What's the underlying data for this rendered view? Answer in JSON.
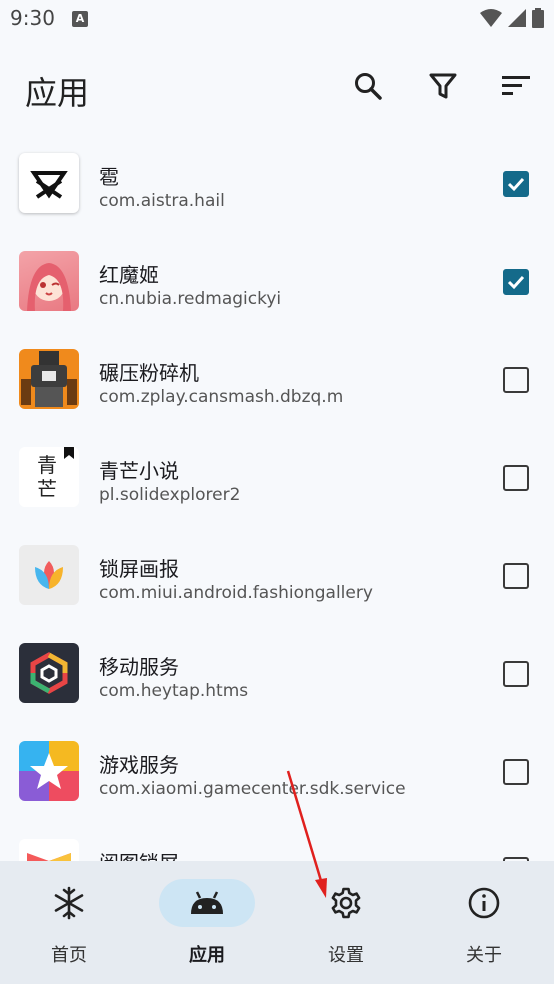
{
  "status": {
    "time": "9:30"
  },
  "appbar": {
    "title": "应用"
  },
  "apps": [
    {
      "name": "雹",
      "package": "com.aistra.hail",
      "checked": true
    },
    {
      "name": "红魔姬",
      "package": "cn.nubia.redmagickyi",
      "checked": true
    },
    {
      "name": "碾压粉碎机",
      "package": "com.zplay.cansmash.dbzq.m",
      "checked": false
    },
    {
      "name": "青芒小说",
      "package": "pl.solidexplorer2",
      "checked": false
    },
    {
      "name": "锁屏画报",
      "package": "com.miui.android.fashiongallery",
      "checked": false
    },
    {
      "name": "移动服务",
      "package": "com.heytap.htms",
      "checked": false
    },
    {
      "name": "游戏服务",
      "package": "com.xiaomi.gamecenter.sdk.service",
      "checked": false
    },
    {
      "name": "阅图锁屏",
      "package": "",
      "checked": false
    }
  ],
  "app_icon_text": {
    "qingmang": "青\n芒"
  },
  "nav": {
    "home": "首页",
    "apps": "应用",
    "settings": "设置",
    "about": "关于"
  },
  "colors": {
    "accent": "#146a8a",
    "nav_active_pill": "#cde5f4",
    "arrow": "#e0201e"
  }
}
